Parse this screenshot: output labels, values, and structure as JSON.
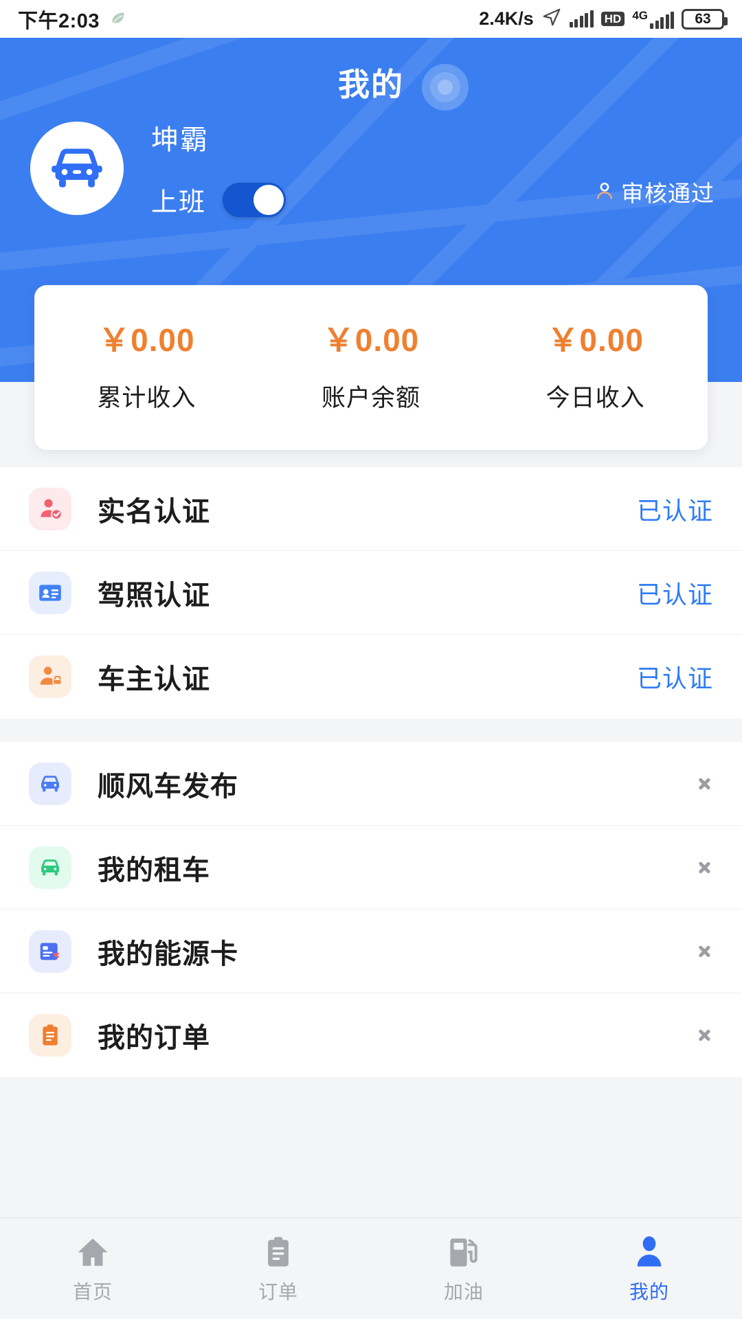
{
  "statusbar": {
    "time": "下午2:03",
    "leaf_icon": "leaf-icon",
    "network_speed": "2.4K/s",
    "location_icon": "location-arrow-icon",
    "signal_icon": "signal-bars-icon",
    "hd_badge": "HD",
    "network_type": "4G",
    "battery_level": "63"
  },
  "header": {
    "title": "我的",
    "avatar_icon": "car-front-avatar-icon",
    "nickname": "坤霸",
    "shift_label": "上班",
    "shift_on": true,
    "audit_icon": "person-outline-icon",
    "audit_status": "审核通过",
    "bg_color": "#3b7ef0"
  },
  "stats": {
    "items": [
      {
        "amount": "￥0.00",
        "label": "累计收入"
      },
      {
        "amount": "￥0.00",
        "label": "账户余额"
      },
      {
        "amount": "￥0.00",
        "label": "今日收入"
      }
    ],
    "amount_color": "#ef8030"
  },
  "verification": {
    "items": [
      {
        "icon": "id-person-check-icon",
        "label": "实名认证",
        "status": "已认证"
      },
      {
        "icon": "driver-license-card-icon",
        "label": "驾照认证",
        "status": "已认证"
      },
      {
        "icon": "car-owner-person-icon",
        "label": "车主认证",
        "status": "已认证"
      }
    ],
    "status_color": "#2f7cf6"
  },
  "menu": {
    "items": [
      {
        "icon": "car-blue-icon",
        "label": "顺风车发布"
      },
      {
        "icon": "car-green-icon",
        "label": "我的租车"
      },
      {
        "icon": "energy-card-icon",
        "label": "我的能源卡"
      },
      {
        "icon": "clipboard-orange-icon",
        "label": "我的订单"
      }
    ]
  },
  "tabbar": {
    "items": [
      {
        "icon": "home-icon",
        "label": "首页",
        "active": false
      },
      {
        "icon": "clipboard-icon",
        "label": "订单",
        "active": false
      },
      {
        "icon": "fuel-pump-icon",
        "label": "加油",
        "active": false
      },
      {
        "icon": "person-icon",
        "label": "我的",
        "active": true
      }
    ],
    "active_color": "#2f6ef5",
    "inactive_color": "#a6a8ad"
  }
}
